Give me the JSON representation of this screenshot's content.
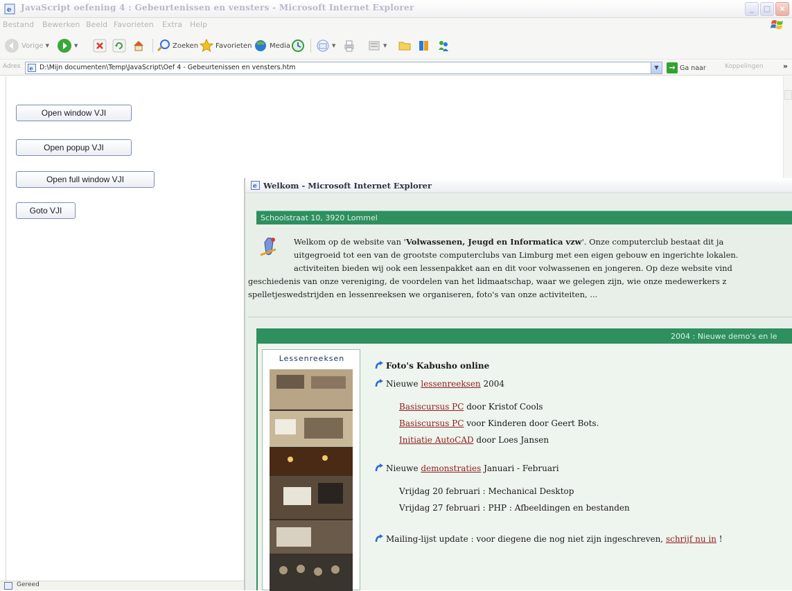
{
  "window": {
    "title": "JavaScript oefening 4 : Gebeurtenissen en vensters - Microsoft Internet Explorer",
    "controls": {
      "minimize": "_",
      "maximize": "□",
      "close": "×"
    }
  },
  "menu": [
    "Bestand",
    "Bewerken",
    "Beeld",
    "Favorieten",
    "Extra",
    "Help"
  ],
  "toolbar": {
    "back": "Vorige",
    "search": "Zoeken",
    "favorites": "Favorieten",
    "media": "Media"
  },
  "address": {
    "label": "Adres",
    "url": "D:\\Mijn documenten\\Temp\\JavaScript\\Oef 4 - Gebeurtenissen en vensters.htm",
    "go": "Ga naar",
    "links": "Koppelingen",
    "chevron": "»"
  },
  "page": {
    "buttons": [
      "Open window VJI",
      "Open popup VJI",
      "Open full window VJI",
      "Goto VJI"
    ]
  },
  "status": {
    "text": "Gereed"
  },
  "popup": {
    "title": "Welkom - Microsoft Internet Explorer",
    "address_bar": "Schoolstraat 10,  3920 Lommel",
    "intro": {
      "l1_pre": "Welkom op de website van '",
      "l1_bold": "Volwassenen, Jeugd en Informatica vzw",
      "l1_post": "'. Onze computerclub bestaat dit ja",
      "l2": "uitgegroeid tot een van de grootste computerclubs van Limburg met een eigen gebouw en ingerichte lokalen.",
      "l3": "activiteiten bieden wij ook een lessenpakket aan en dit voor volwassenen en jongeren. Op deze website vind",
      "l4": "geschiedenis van onze vereniging, de voordelen van het lidmaatschap, waar we gelegen zijn, wie onze medewerkers z",
      "l5": "spelletjeswedstrijden en  lessenreeksen we organiseren, foto's van onze activiteiten, ..."
    },
    "news_header": "2004 : Nieuwe demo's en le",
    "sidebar_title": "Lessenreeksen",
    "news": {
      "item1_bold": "Foto's Kabusho online",
      "item2_pre": "Nieuwe ",
      "item2_link": "lessenreeksen",
      "item2_post": " 2004",
      "course1_link": "Basiscursus PC",
      "course1_post": " door Kristof Cools",
      "course2_link": "Basiscursus PC",
      "course2_post": " voor Kinderen door Geert Bots.",
      "course3_link": "Initiatie AutoCAD",
      "course3_post": " door Loes Jansen",
      "item3_pre": "Nieuwe ",
      "item3_link": "demonstraties",
      "item3_post": " Januari - Februari",
      "demo1": "Vrijdag 20 februari : Mechanical Desktop",
      "demo2": "Vrijdag 27 februari : PHP : Afbeeldingen en bestanden",
      "item4_pre": "Mailing-lijst update : voor diegene die nog niet zijn ingeschreven, ",
      "item4_link": "schrijf nu in",
      "item4_post": " !"
    }
  },
  "colors": {
    "green": "#2e8f5f",
    "link": "#8f1d1d",
    "button_border": "#7b8db2"
  },
  "icons": [
    "ie-page-icon",
    "back-arrow-icon",
    "forward-arrow-icon",
    "stop-icon",
    "refresh-icon",
    "home-icon",
    "search-icon",
    "favorites-star-icon",
    "media-icon",
    "history-icon",
    "mail-icon",
    "print-icon",
    "edit-icon",
    "folder-icon",
    "messenger-icon",
    "go-arrow-icon",
    "windows-logo-icon",
    "bullet-arrow-icon"
  ]
}
